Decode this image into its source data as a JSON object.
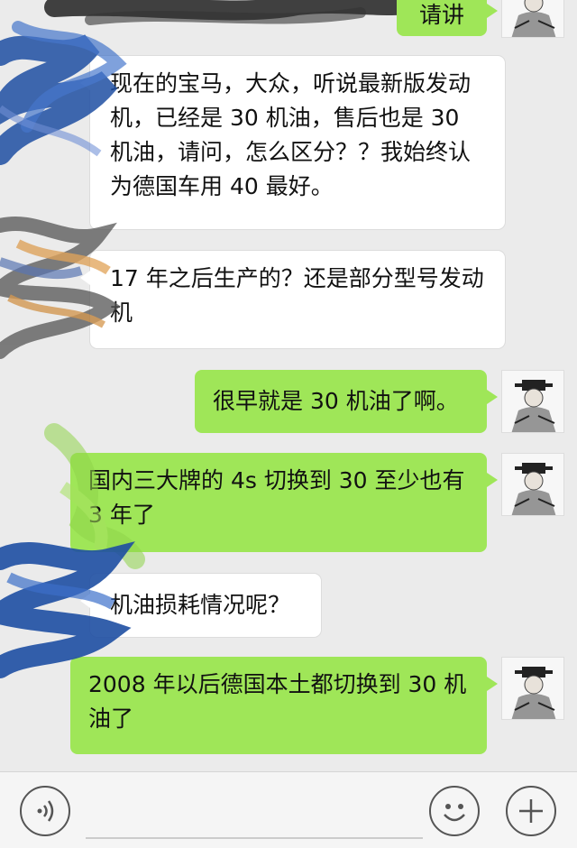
{
  "messages": [
    {
      "side": "out",
      "text": "请讲"
    },
    {
      "side": "in",
      "text": "现在的宝马，大众，听说最新版发动机，已经是 30 机油，售后也是 30 机油，请问，怎么区分？？我始终认为德国车用 40 最好。"
    },
    {
      "side": "in",
      "text": "17 年之后生产的？还是部分型号发动机"
    },
    {
      "side": "out",
      "text": "很早就是 30 机油了啊。"
    },
    {
      "side": "out",
      "text": "国内三大牌的 4s 切换到 30 至少也有 3 年了"
    },
    {
      "side": "in",
      "text": "机油损耗情况呢？"
    },
    {
      "side": "out",
      "text": "2008 年以后德国本土都切换到 30 机油了"
    }
  ],
  "input": {
    "placeholder": "",
    "value": ""
  },
  "icons": {
    "voice": "voice-icon",
    "emoji": "emoji-icon",
    "plus": "plus-icon"
  },
  "colors": {
    "outgoing_bubble": "#9fe658",
    "incoming_bubble": "#ffffff",
    "background": "#ebebeb"
  }
}
